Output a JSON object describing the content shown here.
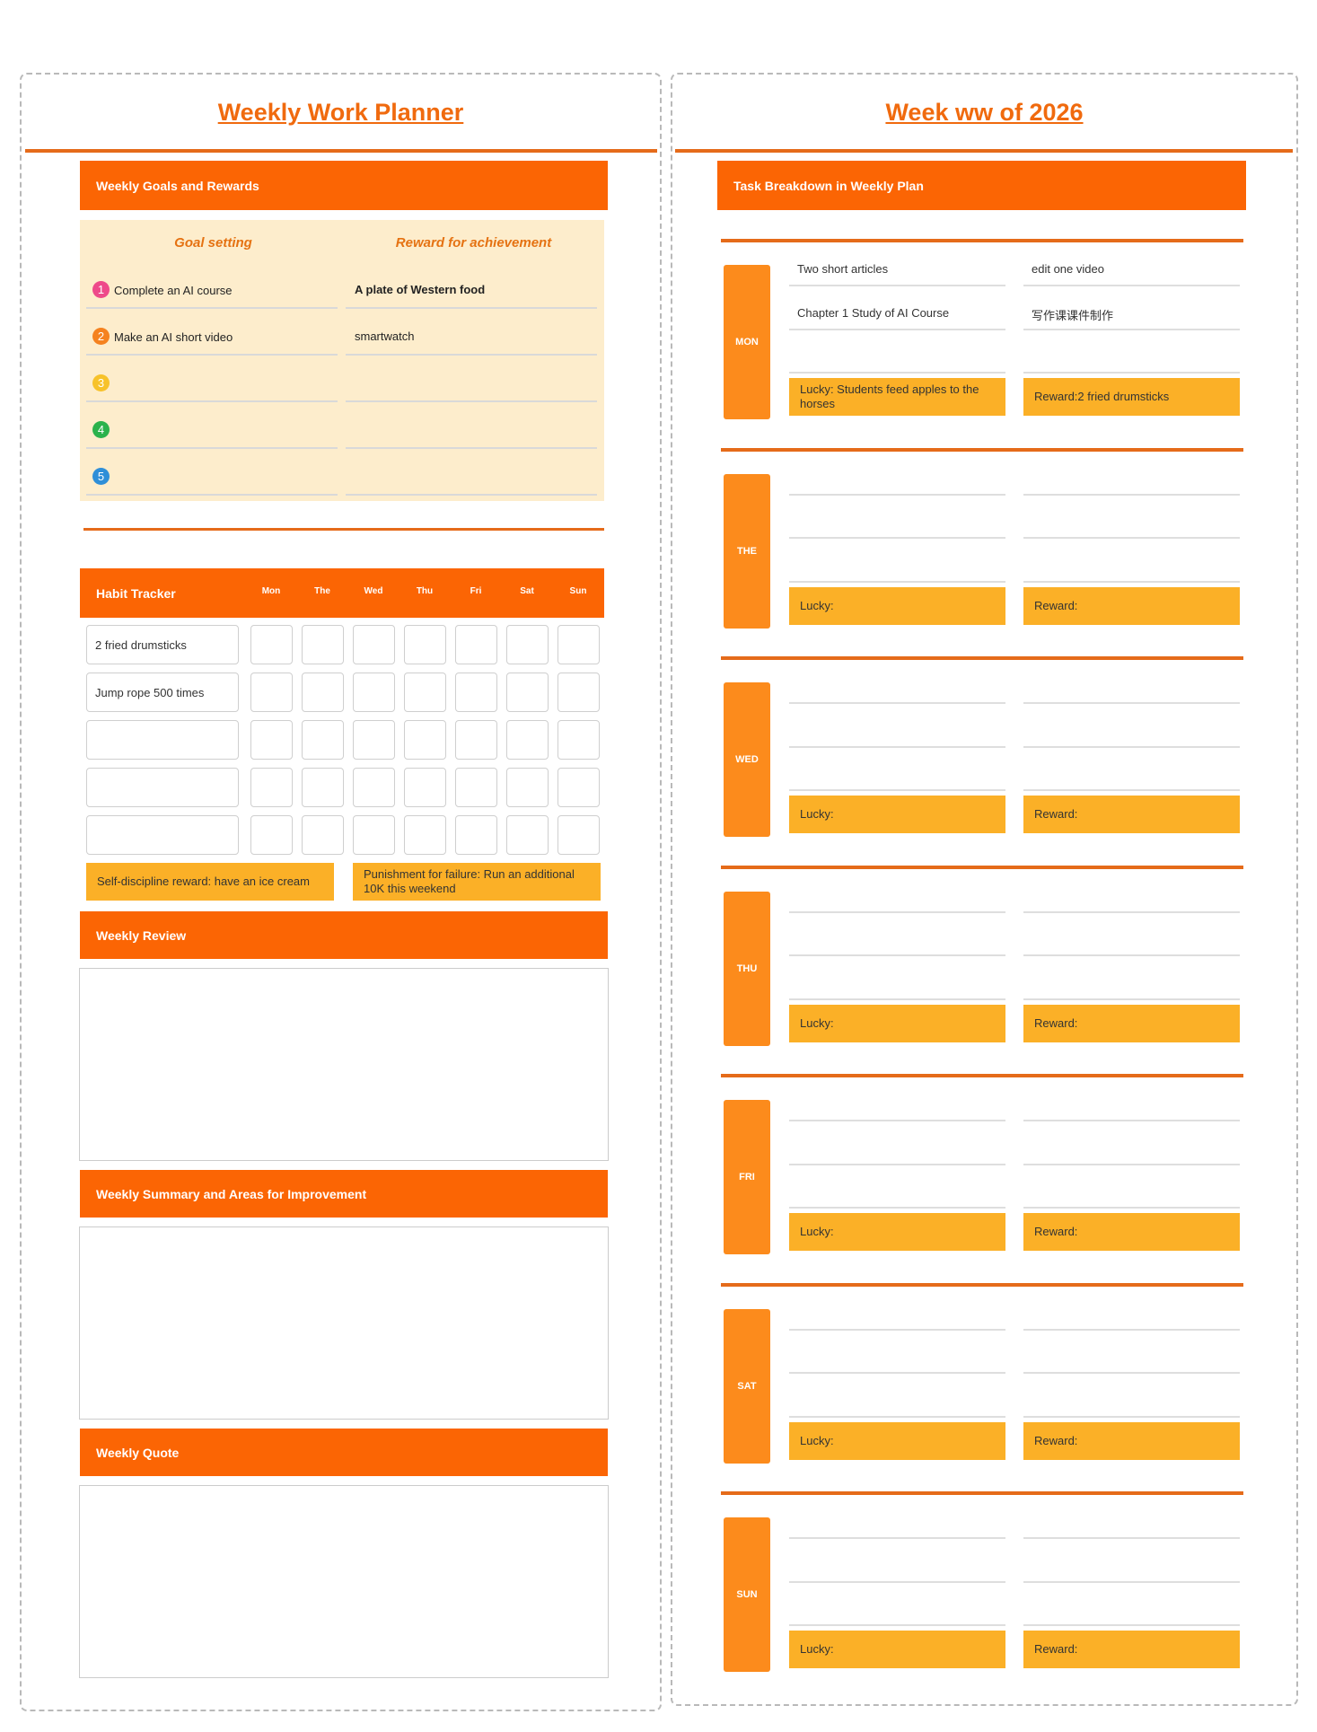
{
  "left": {
    "title": "Weekly Work Planner",
    "goals_header": "Weekly Goals and Rewards",
    "goal_col": "Goal setting",
    "reward_col": "Reward for achievement",
    "goals": [
      {
        "num": "1",
        "color": "#ee4a8a",
        "goal": "Complete an AI course",
        "reward": "A plate of Western food"
      },
      {
        "num": "2",
        "color": "#f5821f",
        "goal": "Make an AI short video",
        "reward": "smartwatch"
      },
      {
        "num": "3",
        "color": "#f7c22a",
        "goal": "",
        "reward": ""
      },
      {
        "num": "4",
        "color": "#2bb24c",
        "goal": "",
        "reward": ""
      },
      {
        "num": "5",
        "color": "#2f8fd8",
        "goal": "",
        "reward": ""
      }
    ],
    "habit": {
      "header": "Habit Tracker",
      "days": [
        "Mon",
        "The",
        "Wed",
        "Thu",
        "Fri",
        "Sat",
        "Sun"
      ],
      "rows": [
        "2 fried drumsticks",
        "Jump rope 500 times",
        "",
        "",
        ""
      ],
      "reward": "Self-discipline reward: have an ice cream",
      "punishment": "Punishment for failure: Run an additional 10K this weekend"
    },
    "review_header": "Weekly Review",
    "summary_header": "Weekly Summary and Areas for Improvement",
    "quote_header": "Weekly Quote"
  },
  "right": {
    "title": "Week ww of 2026",
    "header": "Task Breakdown in Weekly Plan",
    "days": [
      {
        "label": "MON",
        "tasks": [
          [
            "Two short articles",
            "edit one video"
          ],
          [
            "Chapter 1 Study of AI Course",
            "写作课课件制作"
          ],
          [
            "",
            ""
          ]
        ],
        "lucky": "Lucky: Students feed apples to the horses",
        "reward": "Reward:2 fried drumsticks"
      },
      {
        "label": "THE",
        "tasks": [
          [
            "",
            ""
          ],
          [
            "",
            ""
          ],
          [
            "",
            ""
          ]
        ],
        "lucky": "Lucky:",
        "reward": "Reward:"
      },
      {
        "label": "WED",
        "tasks": [
          [
            "",
            ""
          ],
          [
            "",
            ""
          ],
          [
            "",
            ""
          ]
        ],
        "lucky": "Lucky:",
        "reward": "Reward:"
      },
      {
        "label": "THU",
        "tasks": [
          [
            "",
            ""
          ],
          [
            "",
            ""
          ],
          [
            "",
            ""
          ]
        ],
        "lucky": "Lucky:",
        "reward": "Reward:"
      },
      {
        "label": "FRI",
        "tasks": [
          [
            "",
            ""
          ],
          [
            "",
            ""
          ],
          [
            "",
            ""
          ]
        ],
        "lucky": "Lucky:",
        "reward": "Reward:"
      },
      {
        "label": "SAT",
        "tasks": [
          [
            "",
            ""
          ],
          [
            "",
            ""
          ],
          [
            "",
            ""
          ]
        ],
        "lucky": "Lucky:",
        "reward": "Reward:"
      },
      {
        "label": "SUN",
        "tasks": [
          [
            "",
            ""
          ],
          [
            "",
            ""
          ],
          [
            "",
            ""
          ]
        ],
        "lucky": "Lucky:",
        "reward": "Reward:"
      }
    ]
  }
}
